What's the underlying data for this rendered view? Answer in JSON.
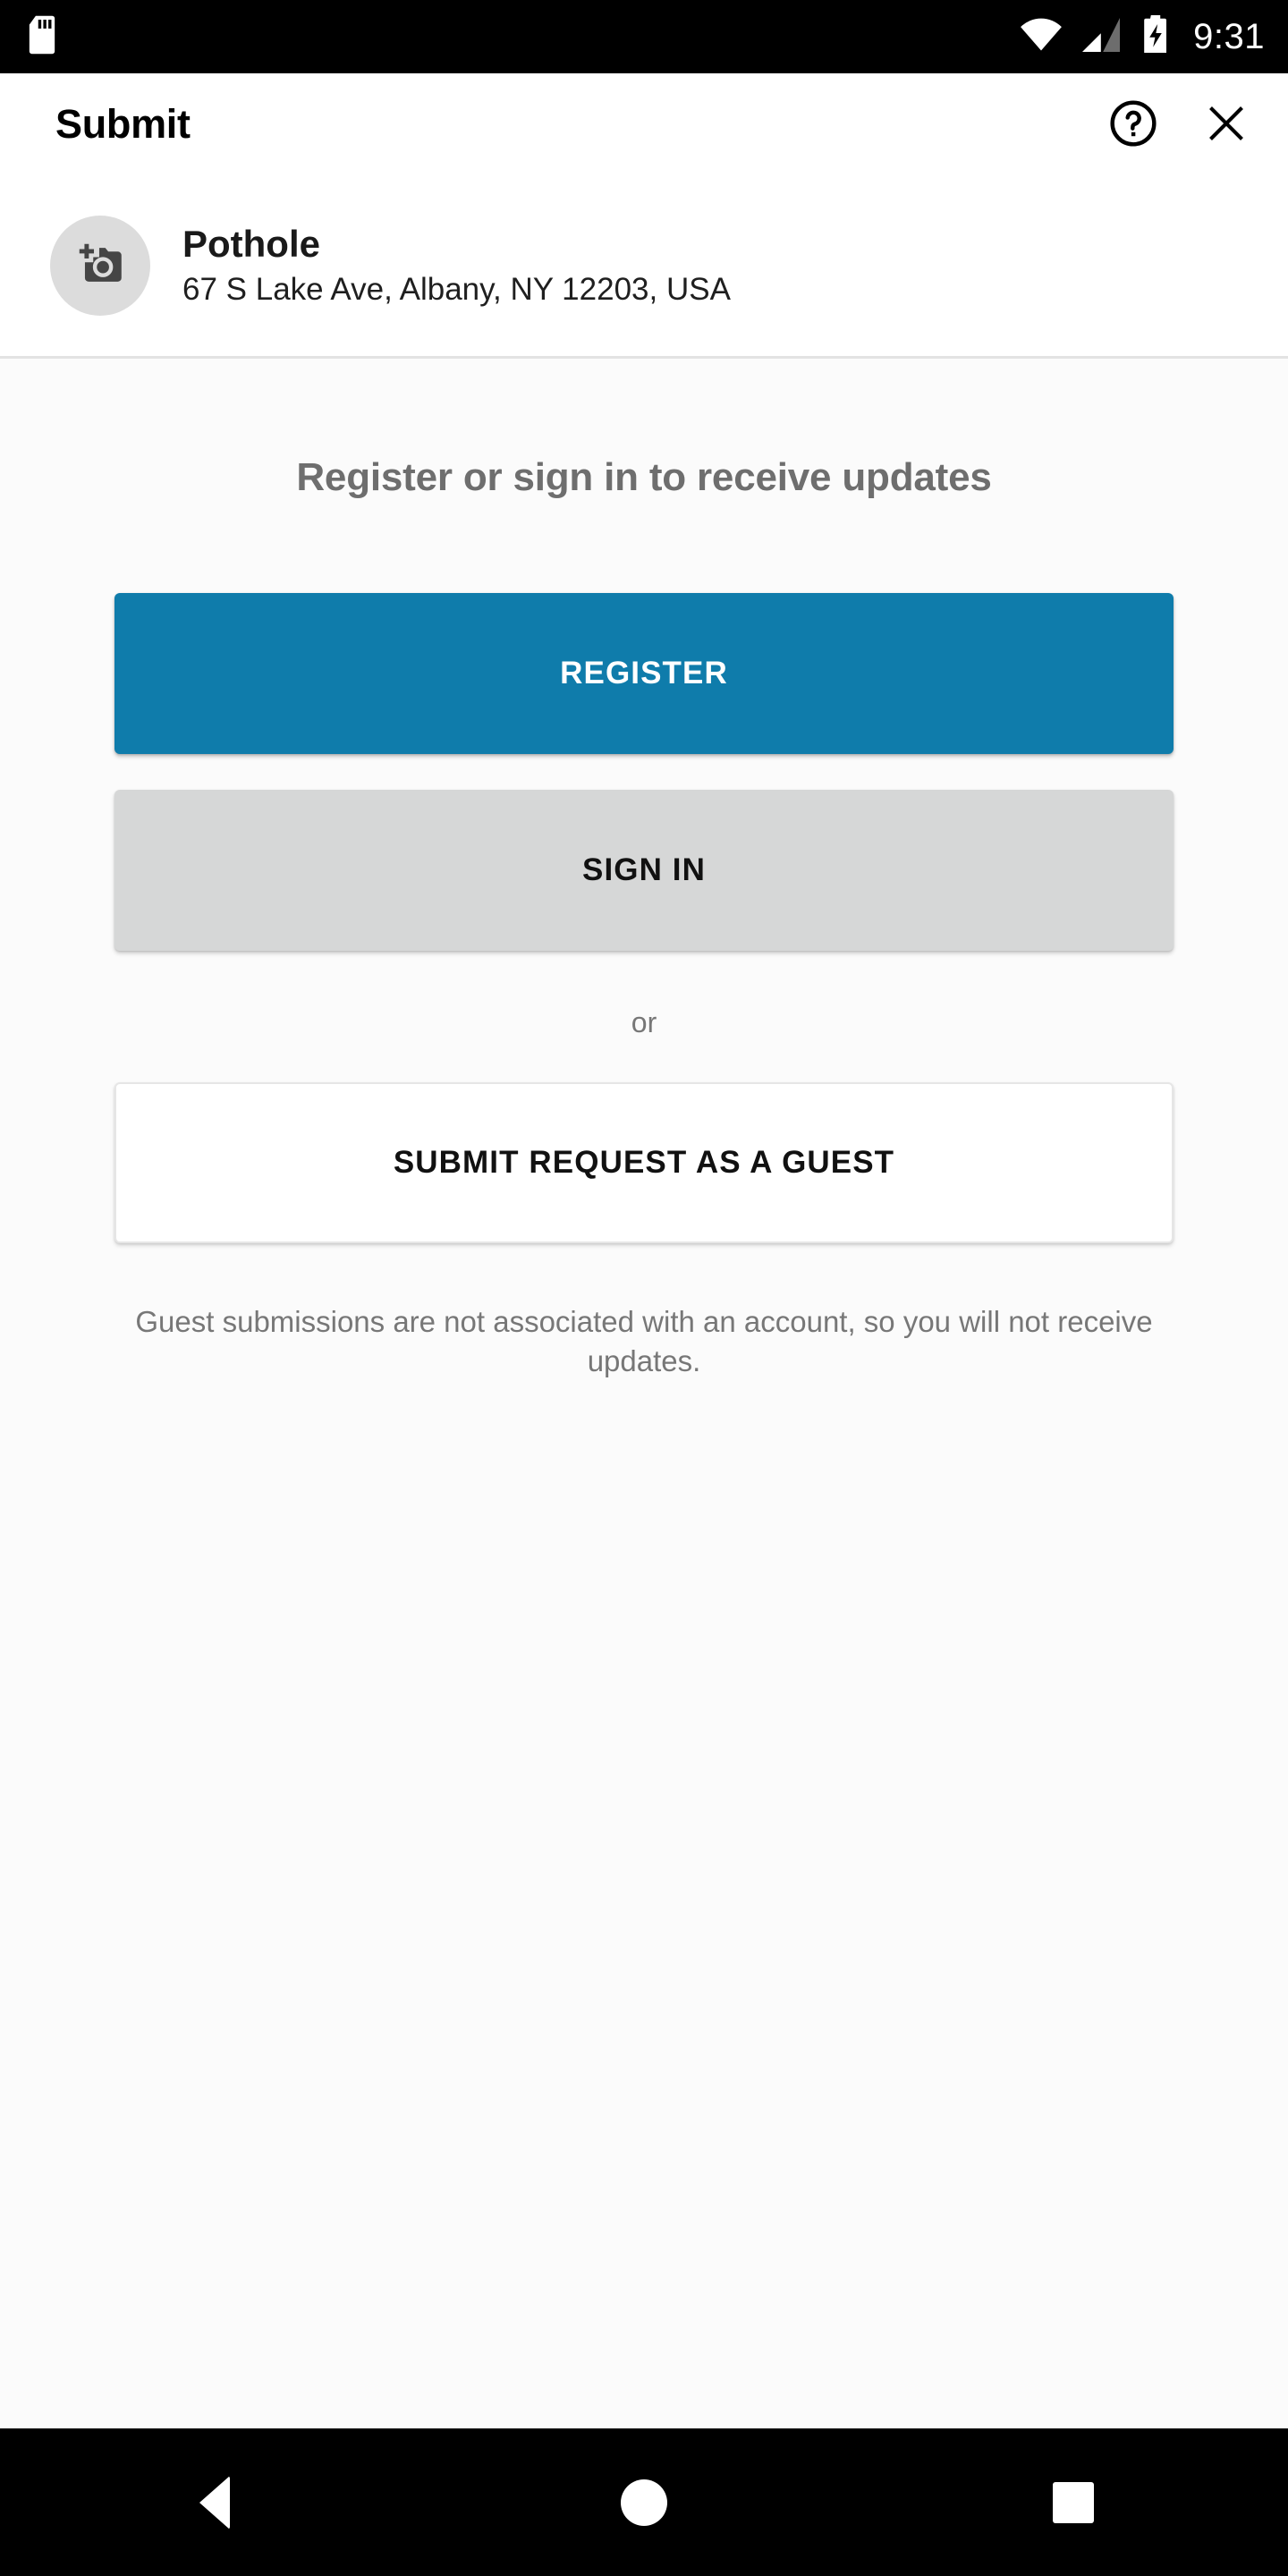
{
  "status_bar": {
    "time": "9:31",
    "icons": [
      "sd-card-icon",
      "wifi-icon",
      "cellular-signal-icon",
      "battery-charging-icon"
    ]
  },
  "appbar": {
    "title": "Submit",
    "help_icon": "help-circle-icon",
    "close_icon": "close-icon"
  },
  "summary": {
    "thumbnail_icon": "add-a-photo-icon",
    "title": "Pothole",
    "address": "67 S Lake Ave, Albany, NY 12203, USA"
  },
  "main": {
    "prompt": "Register or sign in to receive updates",
    "register_label": "REGISTER",
    "signin_label": "SIGN IN",
    "or_label": "or",
    "guest_label": "SUBMIT REQUEST AS A GUEST",
    "guest_note": "Guest submissions are not associated with an account, so you will not receive updates."
  },
  "navbar": {
    "back": "back-button",
    "home": "home-button",
    "recents": "recents-button"
  },
  "colors": {
    "accent": "#0f7cab",
    "secondary_button": "#d6d7d7",
    "muted_text": "#6e6e6e",
    "status_bar": "#000000",
    "thumbnail_bg": "#dcdcdc"
  }
}
